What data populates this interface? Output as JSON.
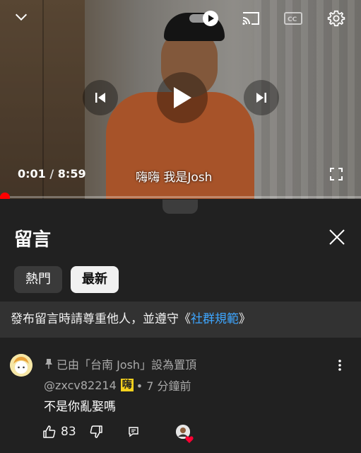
{
  "player": {
    "current_time": "0:01",
    "separator": " / ",
    "duration": "8:59",
    "subtitle": "嗨嗨 我是Josh",
    "progress_fraction": 0.002
  },
  "icons": {
    "collapse": "chevron-down-icon",
    "autoplay": "autoplay-toggle-icon",
    "cast": "cast-icon",
    "captions": "captions-icon",
    "settings": "gear-icon",
    "previous": "previous-icon",
    "play": "play-icon",
    "next": "next-icon",
    "fullscreen": "fullscreen-icon",
    "close": "close-icon",
    "pin": "pin-icon",
    "more": "more-vertical-icon",
    "like": "thumbs-up-icon",
    "dislike": "thumbs-down-icon",
    "reply": "reply-icon",
    "heart": "heart-icon"
  },
  "comments_panel": {
    "title": "留言",
    "tabs": [
      {
        "label": "熱門",
        "selected": false
      },
      {
        "label": "最新",
        "selected": true
      }
    ],
    "notice_prefix": "發布留言時請尊重他人，並遵守《",
    "notice_link": "社群規範",
    "notice_suffix": "》"
  },
  "comment": {
    "pinned_text": "已由「台南 Josh」設為置頂",
    "author": "@zxcv82214",
    "author_emoji": "嗨",
    "time": "• 7 分鐘前",
    "text": "不是你亂娶嗎",
    "likes": "83"
  },
  "colors": {
    "accent_red": "#ff0000",
    "link_blue": "#3ea6ff",
    "sheet_bg": "#212121"
  }
}
